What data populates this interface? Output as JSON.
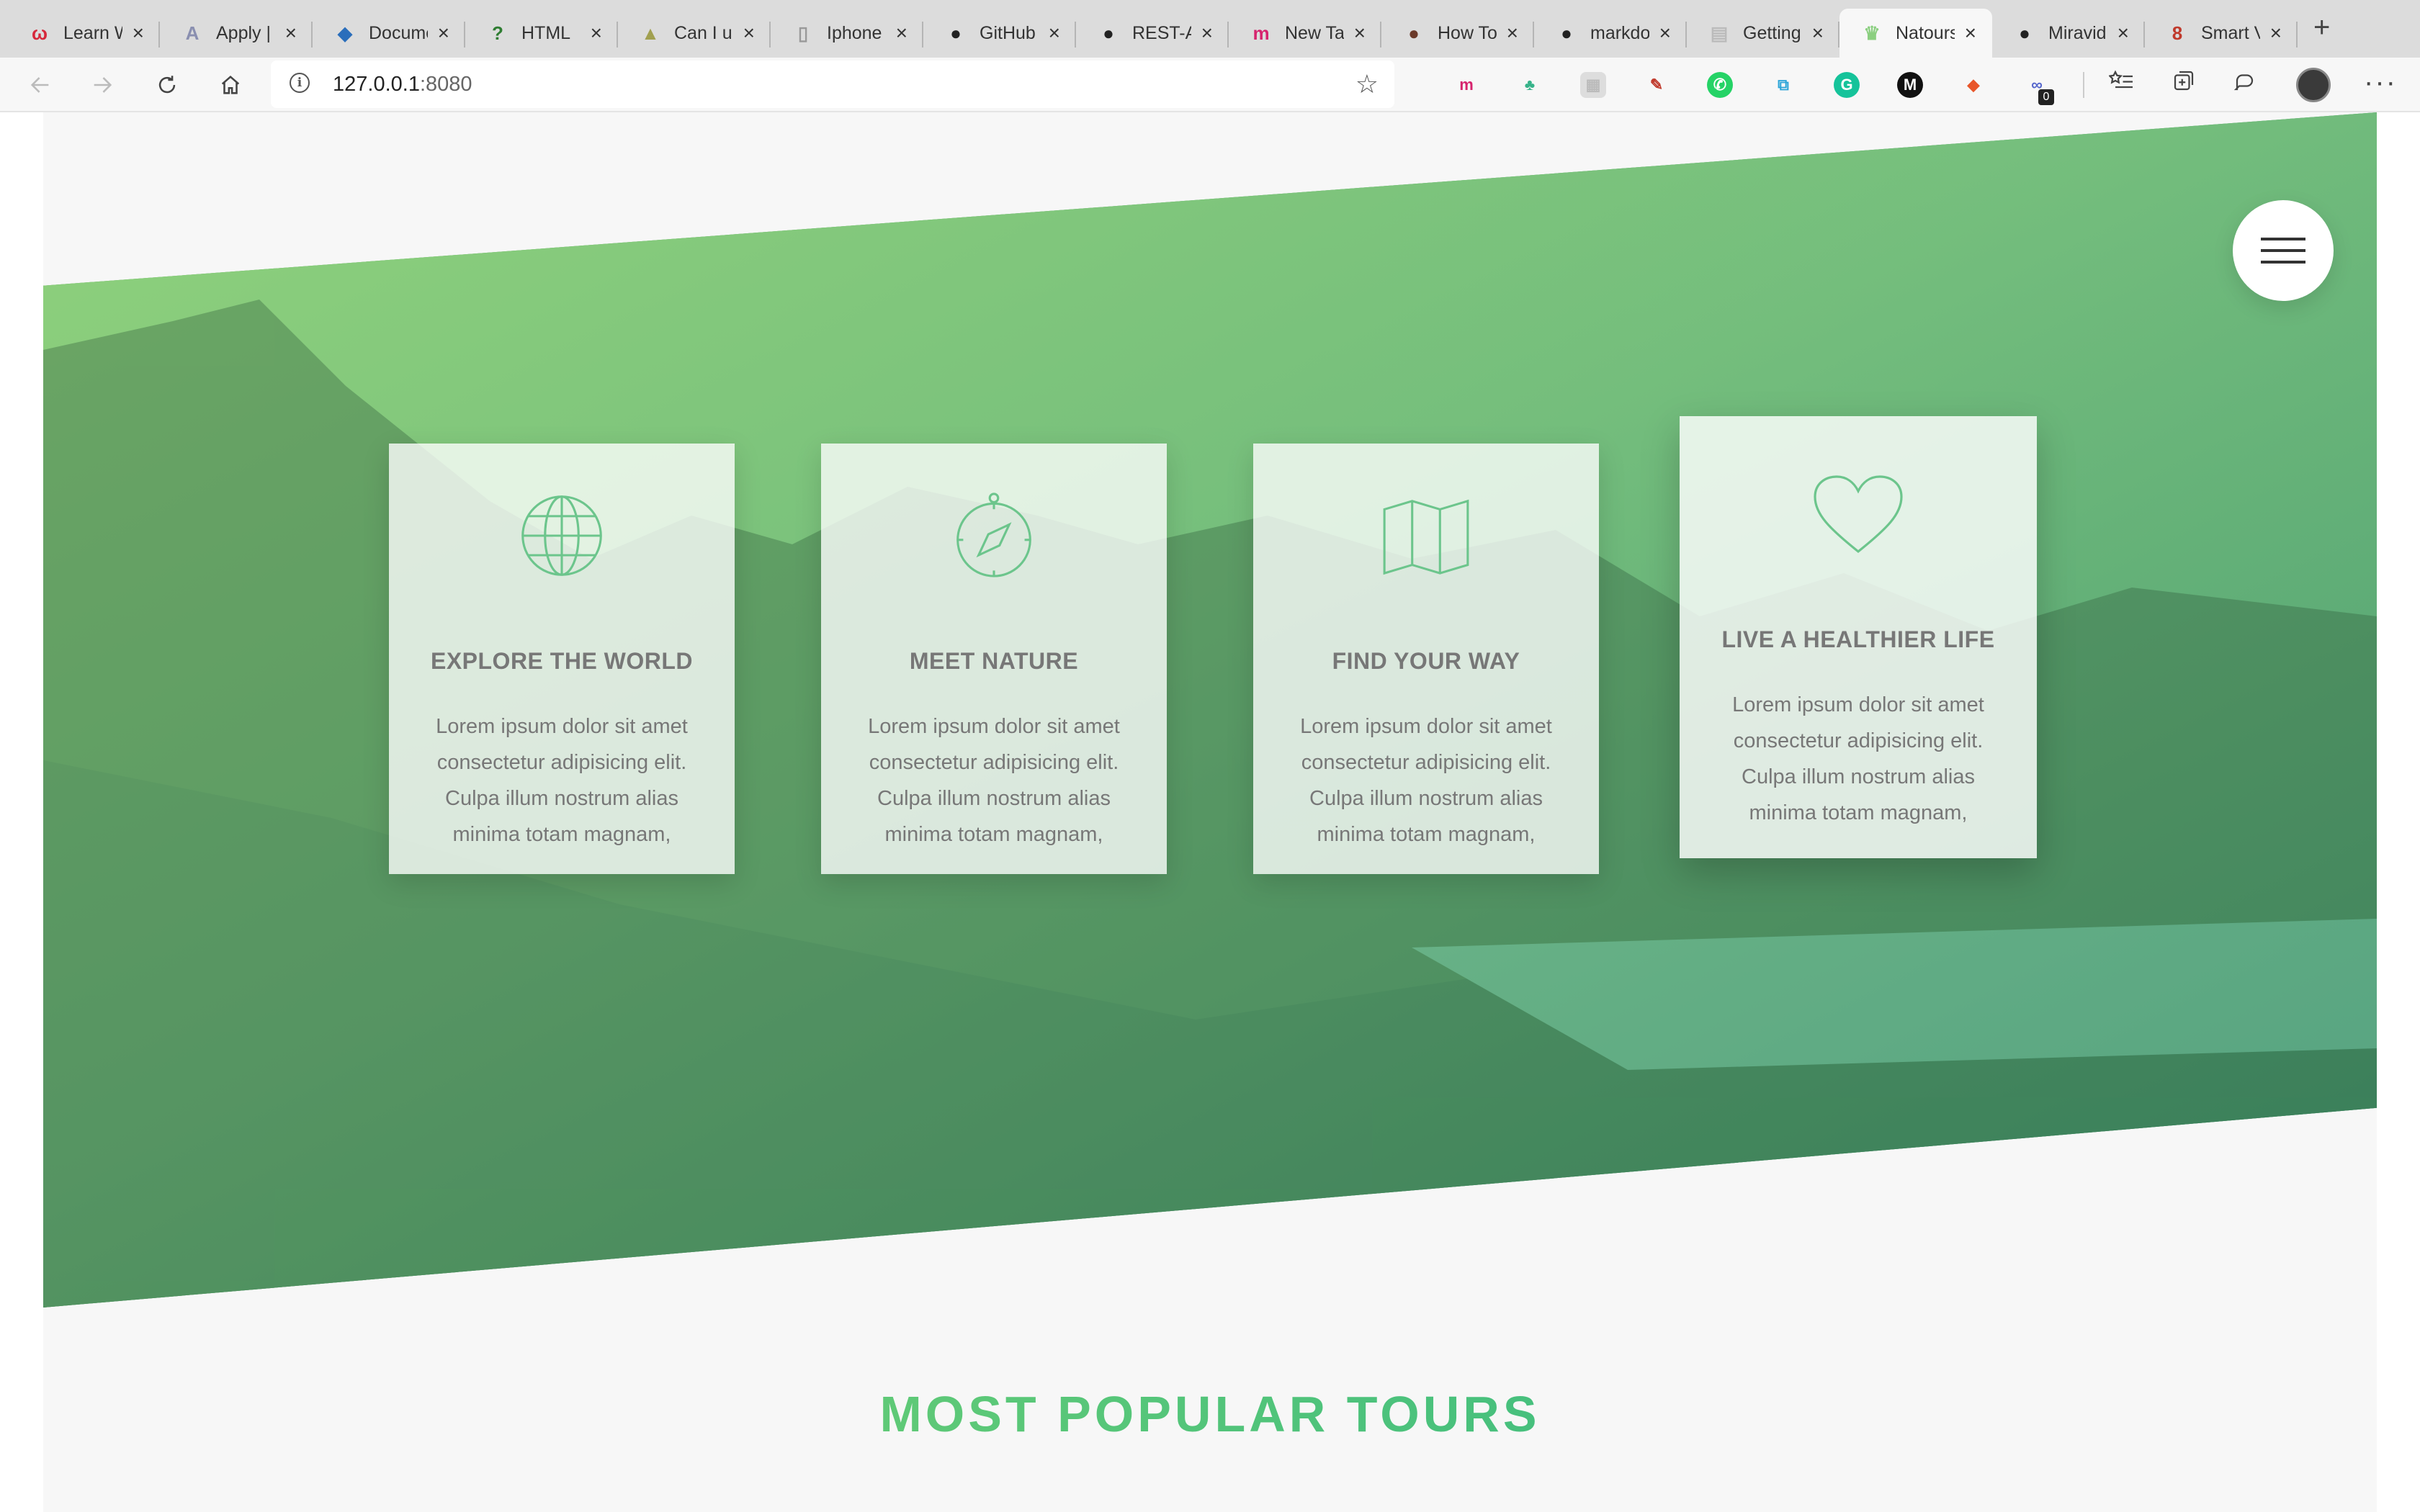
{
  "browser": {
    "tabs": [
      {
        "title": "Learn Web",
        "favicon_color": "#d6283b",
        "favicon_glyph": "ω"
      },
      {
        "title": "Apply | ",
        "favicon_color": "#8a8fb0",
        "favicon_glyph": "A"
      },
      {
        "title": "Document",
        "favicon_color": "#2a6ebb",
        "favicon_glyph": "◆"
      },
      {
        "title": "HTML",
        "favicon_color": "#2f7d32",
        "favicon_glyph": "?"
      },
      {
        "title": "Can I u",
        "favicon_color": "#a1a050",
        "favicon_glyph": "▲"
      },
      {
        "title": "Iphone",
        "favicon_color": "#999999",
        "favicon_glyph": "▯"
      },
      {
        "title": "GitHub",
        "favicon_color": "#222222",
        "favicon_glyph": "●"
      },
      {
        "title": "REST-A",
        "favicon_color": "#222222",
        "favicon_glyph": "●"
      },
      {
        "title": "New Ta",
        "favicon_color": "#d6246e",
        "favicon_glyph": "m"
      },
      {
        "title": "How To",
        "favicon_color": "#6b3a2a",
        "favicon_glyph": "●"
      },
      {
        "title": "markdo",
        "favicon_color": "#222222",
        "favicon_glyph": "●"
      },
      {
        "title": "Getting",
        "favicon_color": "#bbbbbb",
        "favicon_glyph": "▤"
      },
      {
        "title": "Natours",
        "favicon_color": "#8bcf80",
        "favicon_glyph": "♛",
        "active": true
      },
      {
        "title": "Miravid",
        "favicon_color": "#222222",
        "favicon_glyph": "●"
      },
      {
        "title": "Smart V",
        "favicon_color": "#c0392b",
        "favicon_glyph": "8"
      }
    ],
    "close_glyph": "×",
    "new_tab_glyph": "+",
    "url_host": "127.0.0.1",
    "url_port": ":8080",
    "info_glyph": "i",
    "star_glyph": "☆",
    "more_glyph": "···",
    "extensions": [
      {
        "name": "m-extension-icon",
        "color": "#ffffff",
        "fg": "#d6246e",
        "glyph": "m"
      },
      {
        "name": "tree-extension-icon",
        "color": "#ffffff",
        "fg": "#37b38a",
        "glyph": "♣"
      },
      {
        "name": "grid-extension-icon",
        "color": "#dddddd",
        "fg": "#bbbbbb",
        "glyph": "▦"
      },
      {
        "name": "pen-extension-icon",
        "color": "#ffffff",
        "fg": "#c0392b",
        "glyph": "✎"
      },
      {
        "name": "whatsapp-extension-icon",
        "color": "#25d366",
        "fg": "#ffffff",
        "glyph": "✆"
      },
      {
        "name": "copy-extension-icon",
        "color": "#ffffff",
        "fg": "#2aa4d8",
        "glyph": "⧉"
      },
      {
        "name": "grammarly-extension-icon",
        "color": "#15c39a",
        "fg": "#ffffff",
        "glyph": "G"
      },
      {
        "name": "m-dark-extension-icon",
        "color": "#111111",
        "fg": "#ffffff",
        "glyph": "M"
      },
      {
        "name": "fox-extension-icon",
        "color": "#ffffff",
        "fg": "#e8562a",
        "glyph": "◆"
      },
      {
        "name": "link-extension-icon",
        "color": "#ffffff",
        "fg": "#5566cc",
        "glyph": "∞"
      }
    ],
    "extension_badge": "0"
  },
  "hero": {
    "features": [
      {
        "icon": "globe-icon",
        "title": "Explore the world",
        "text": "Lorem ipsum dolor sit amet consectetur adipisicing elit. Culpa illum nostrum alias minima totam magnam,"
      },
      {
        "icon": "compass-icon",
        "title": "Meet nature",
        "text": "Lorem ipsum dolor sit amet consectetur adipisicing elit. Culpa illum nostrum alias minima totam magnam,"
      },
      {
        "icon": "map-icon",
        "title": "Find your way",
        "text": "Lorem ipsum dolor sit amet consectetur adipisicing elit. Culpa illum nostrum alias minima totam magnam,"
      },
      {
        "icon": "heart-icon",
        "title": "Live a healthier life",
        "text": "Lorem ipsum dolor sit amet consectetur adipisicing elit. Culpa illum nostrum alias minima totam magnam,"
      }
    ]
  },
  "tours": {
    "section_title": "Most popular tours"
  },
  "colors": {
    "primary_light": "#7ed56f",
    "primary_dark": "#28b485",
    "page_bg": "#f7f7f7",
    "text_grey": "#777777"
  }
}
